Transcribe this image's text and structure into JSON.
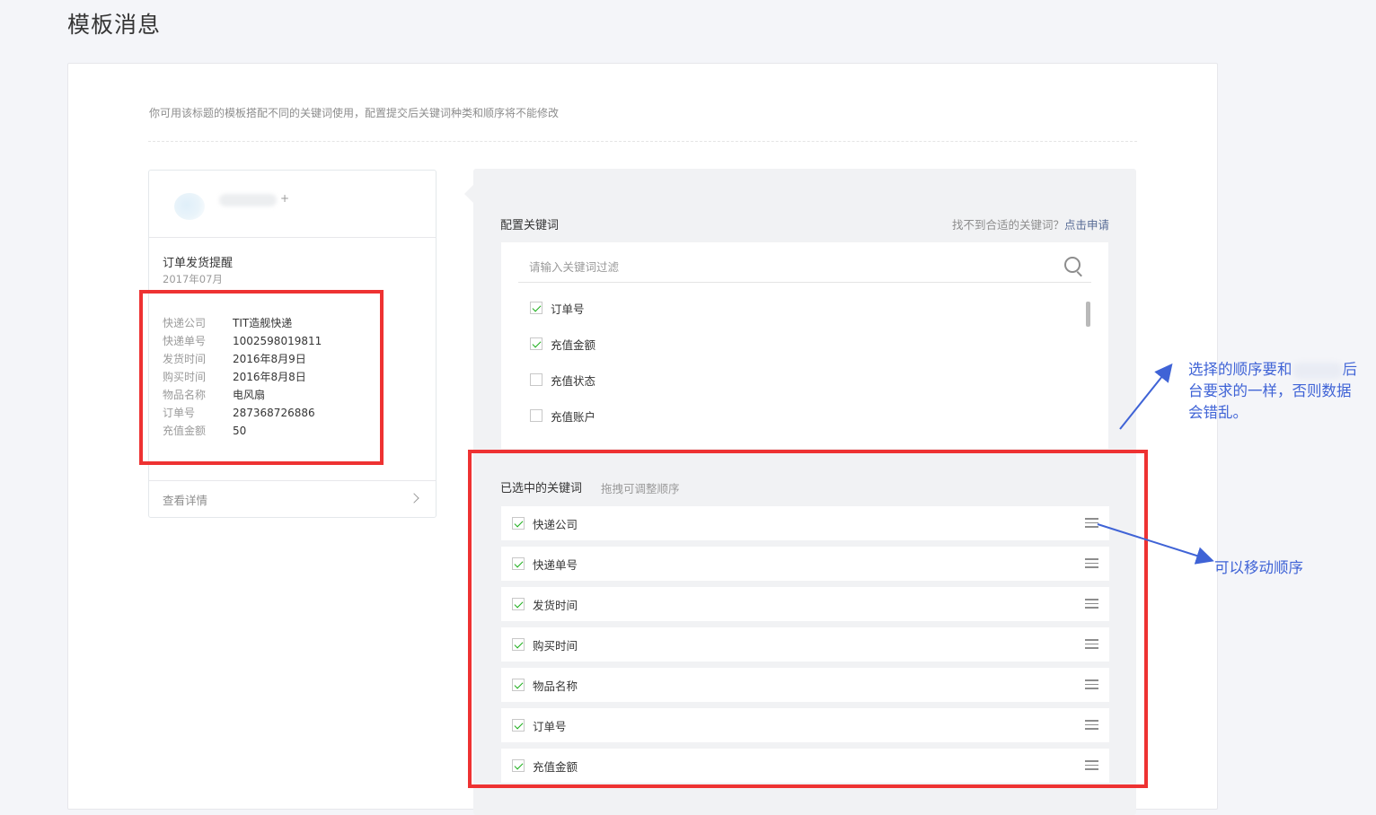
{
  "page": {
    "title": "模板消息"
  },
  "notice": "你可用该标题的模板搭配不同的关键词使用，配置提交后关键词种类和顺序将不能修改",
  "preview": {
    "plus": "+",
    "title": "订单发货提醒",
    "date": "2017年07月",
    "fields": [
      {
        "key": "快递公司",
        "value": "TIT造舰快递"
      },
      {
        "key": "快递单号",
        "value": "1002598019811"
      },
      {
        "key": "发货时间",
        "value": "2016年8月9日"
      },
      {
        "key": "购买时间",
        "value": "2016年8月8日"
      },
      {
        "key": "物品名称",
        "value": "电风扇"
      },
      {
        "key": "订单号",
        "value": "287368726886"
      },
      {
        "key": "充值金额",
        "value": "50"
      }
    ],
    "detail_label": "查看详情"
  },
  "config": {
    "label": "配置关键词",
    "help_text": "找不到合适的关键词？",
    "help_link": "点击申请",
    "search_placeholder": "请输入关键词过滤",
    "keywords": [
      {
        "label": "订单号",
        "checked": true
      },
      {
        "label": "充值金额",
        "checked": true
      },
      {
        "label": "充值状态",
        "checked": false
      },
      {
        "label": "充值账户",
        "checked": false
      }
    ],
    "selected_label": "已选中的关键词",
    "selected_hint": "拖拽可调整顺序",
    "selected": [
      "快递公司",
      "快递单号",
      "发货时间",
      "购买时间",
      "物品名称",
      "订单号",
      "充值金额"
    ]
  },
  "annotations": {
    "note1_line1_a": "选择的顺序要和",
    "note1_line1_b": "后",
    "note1_line2": "台要求的一样，否则数据",
    "note1_line3": "会错乱。",
    "note2": "可以移动顺序",
    "color_red": "#ee3232",
    "color_blue": "#3f63d6"
  }
}
